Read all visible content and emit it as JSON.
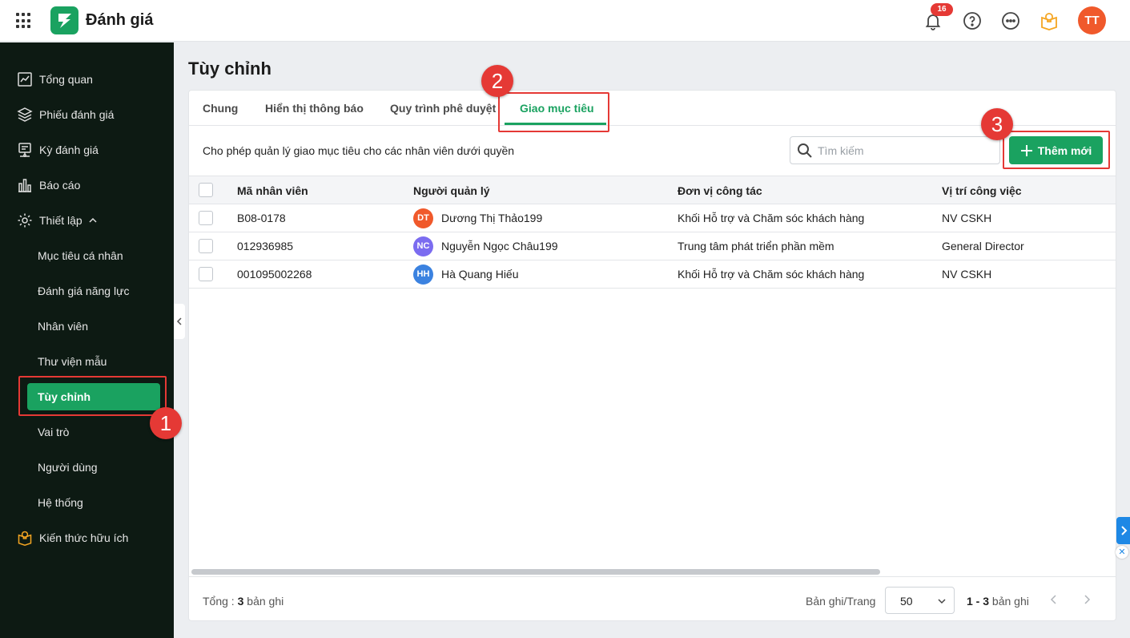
{
  "app": {
    "title": "Đánh giá",
    "avatar": "TT",
    "notification_count": "16"
  },
  "sidebar": {
    "items": [
      {
        "label": "Tổng quan",
        "icon": "chart-line-icon"
      },
      {
        "label": "Phiếu đánh giá",
        "icon": "layers-icon"
      },
      {
        "label": "Kỳ đánh giá",
        "icon": "calendar-review-icon"
      },
      {
        "label": "Báo cáo",
        "icon": "bar-report-icon"
      },
      {
        "label": "Thiết lập",
        "icon": "gear-icon",
        "expanded": true
      }
    ],
    "subitems": [
      {
        "label": "Mục tiêu cá nhân"
      },
      {
        "label": "Đánh giá năng lực"
      },
      {
        "label": "Nhân viên"
      },
      {
        "label": "Thư viện mẫu"
      },
      {
        "label": "Tùy chỉnh",
        "active": true
      },
      {
        "label": "Vai trò"
      },
      {
        "label": "Người dùng"
      },
      {
        "label": "Hệ thống"
      }
    ],
    "bottom": {
      "label": "Kiến thức hữu ích",
      "icon": "lightbulb-book-icon"
    }
  },
  "annotations": [
    "1",
    "2",
    "3"
  ],
  "page": {
    "title": "Tùy chỉnh",
    "tabs": [
      {
        "label": "Chung"
      },
      {
        "label": "Hiển thị thông báo"
      },
      {
        "label": "Quy trình phê duyệt"
      },
      {
        "label": "Giao mục tiêu",
        "active": true
      }
    ],
    "description": "Cho phép quản lý giao mục tiêu cho các nhân viên dưới quyền",
    "search_placeholder": "Tìm kiếm",
    "add_button": "Thêm mới"
  },
  "table": {
    "columns": [
      "Mã nhân viên",
      "Người quản lý",
      "Đơn vị công tác",
      "Vị trí công việc"
    ],
    "rows": [
      {
        "code": "B08-0178",
        "manager_initials": "DT",
        "manager_color": "#f0592b",
        "manager": "Dương Thị Thảo199",
        "unit": "Khối Hỗ trợ và Chăm sóc khách hàng",
        "position": "NV CSKH"
      },
      {
        "code": "012936985",
        "manager_initials": "NC",
        "manager_color": "#7b6cf0",
        "manager": "Nguyễn Ngọc Châu199",
        "unit": "Trung tâm phát triển phần mềm",
        "position": "General Director"
      },
      {
        "code": "001095002268",
        "manager_initials": "HH",
        "manager_color": "#3b82e0",
        "manager": "Hà Quang Hiếu",
        "unit": "Khối Hỗ trợ và Chăm sóc khách hàng",
        "position": "NV CSKH"
      }
    ]
  },
  "footer": {
    "total_label": "Tổng :",
    "total_count": "3",
    "total_suffix": "bản ghi",
    "per_page_label": "Bản ghi/Trang",
    "per_page_value": "50",
    "range": "1 - 3",
    "range_suffix": "bản ghi"
  },
  "colors": {
    "brand": "#1aa260",
    "sidebar_bg": "#0d1a13",
    "highlight": "#e53935"
  }
}
